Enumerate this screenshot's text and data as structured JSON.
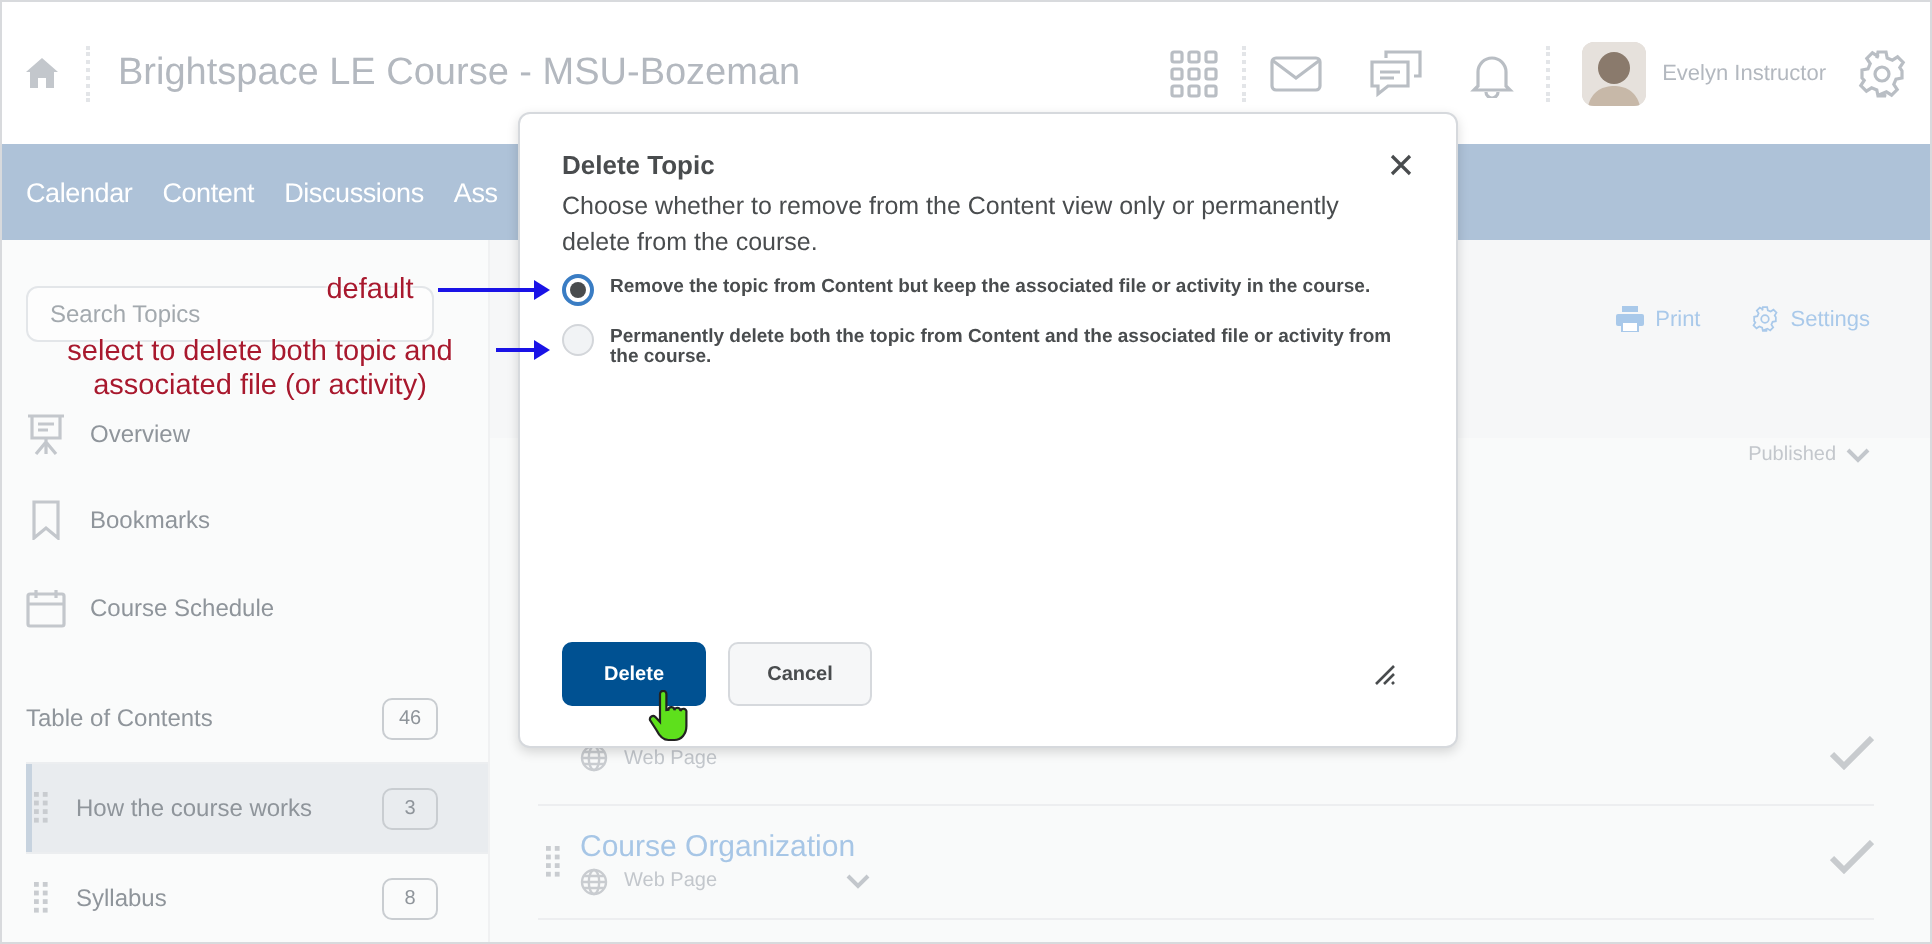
{
  "header": {
    "course_title": "Brightspace LE Course - MSU-Bozeman",
    "user_name": "Evelyn Instructor"
  },
  "nav": {
    "items": [
      "Calendar",
      "Content",
      "Discussions",
      "Ass"
    ]
  },
  "sidebar": {
    "search": {
      "placeholder": "Search Topics"
    },
    "items": [
      {
        "label": "Overview",
        "kind": "overview"
      },
      {
        "label": "Bookmarks",
        "kind": "bookmarks"
      },
      {
        "label": "Course Schedule",
        "kind": "schedule"
      }
    ],
    "toc": {
      "label": "Table of Contents",
      "count": "46"
    },
    "modules": [
      {
        "label": "How the course works",
        "count": "3",
        "selected": true
      },
      {
        "label": "Syllabus",
        "count": "8",
        "selected": false
      }
    ]
  },
  "toolbar": [
    {
      "label": "Print",
      "kind": "print"
    },
    {
      "label": "Settings",
      "kind": "settings"
    }
  ],
  "filter": {
    "label": "Published"
  },
  "topics": [
    {
      "type": "Web Page"
    },
    {
      "title": "Course Organization",
      "type": "Web Page"
    }
  ],
  "dialog": {
    "title": "Delete Topic",
    "message": "Choose whether to remove from the Content view only or permanently delete from the course.",
    "options": [
      {
        "label": "Remove the topic from Content but keep the associated file or activity in the course.",
        "selected": true
      },
      {
        "label": "Permanently delete both the topic from Content and the associated file or activity from the course.",
        "selected": false
      }
    ],
    "buttons": [
      {
        "label": "Delete",
        "kind": "primary"
      },
      {
        "label": "Cancel",
        "kind": "secondary"
      }
    ]
  },
  "annotations": [
    {
      "text": "default"
    },
    {
      "text": "select to delete both topic and associated file (or activity)"
    }
  ]
}
